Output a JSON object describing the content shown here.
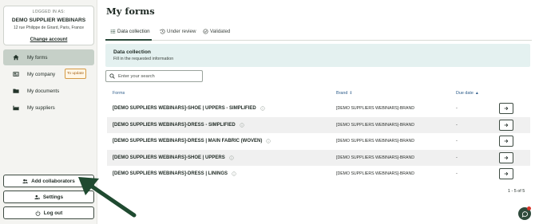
{
  "account": {
    "logged_label": "LOGGED IN AS:",
    "name": "DEMO SUPPLIER WEBINARS",
    "address": "12 rue Philippe de Girard, Paris, France",
    "change_account": "Change account"
  },
  "sidebar": {
    "items": [
      {
        "label": "My forms",
        "icon": "home-icon",
        "active": true
      },
      {
        "label": "My company",
        "icon": "id-card-icon",
        "badge": "To update"
      },
      {
        "label": "My documents",
        "icon": "folder-icon"
      },
      {
        "label": "My suppliers",
        "icon": "factory-icon"
      }
    ],
    "add_collaborators": "Add collaborators",
    "settings": "Settings",
    "logout": "Log out"
  },
  "main": {
    "title": "My forms",
    "tabs": [
      {
        "label": "Data collection",
        "icon": "list-icon",
        "active": true
      },
      {
        "label": "Under review",
        "icon": "history-icon"
      },
      {
        "label": "Validated",
        "icon": "check-circle-icon"
      }
    ],
    "banner": {
      "title": "Data collection",
      "subtitle": "Fill in the requested information"
    },
    "search": {
      "placeholder": "Enter your search"
    },
    "columns": {
      "forms": "Forms",
      "brand": "Brand",
      "due_date": "Due date"
    },
    "rows": [
      {
        "form": "[DEMO SUPPLIERS WEBINARS]-SHOE | UPPERS - SIMPLIFIED",
        "brand": "[DEMO SUPPLIERS WEBINARS]-BRAND",
        "due": "-"
      },
      {
        "form": "[DEMO SUPPLIERS WEBINARS]-DRESS - SIMPLIFIED",
        "brand": "[DEMO SUPPLIERS WEBINARS]-BRAND",
        "due": "-"
      },
      {
        "form": "[DEMO SUPPLIERS WEBINARS]-DRESS | MAIN FABRIC (WOVEN)",
        "brand": "[DEMO SUPPLIERS WEBINARS]-BRAND",
        "due": "-"
      },
      {
        "form": "[DEMO SUPPLIERS WEBINARS]-SHOE | UPPERS",
        "brand": "[DEMO SUPPLIERS WEBINARS]-BRAND",
        "due": "-"
      },
      {
        "form": "[DEMO SUPPLIERS WEBINARS]-DRESS | LININGS",
        "brand": "[DEMO SUPPLIERS WEBINARS]-BRAND",
        "due": "-"
      }
    ],
    "pagination": "1 - 5 of 5"
  },
  "colors": {
    "accent": "#2a4a3a",
    "banner_bg": "#e4f1f0",
    "active_nav": "#c6d0c8",
    "badge_border": "#d49a45",
    "arrow": "#1f4a30"
  }
}
